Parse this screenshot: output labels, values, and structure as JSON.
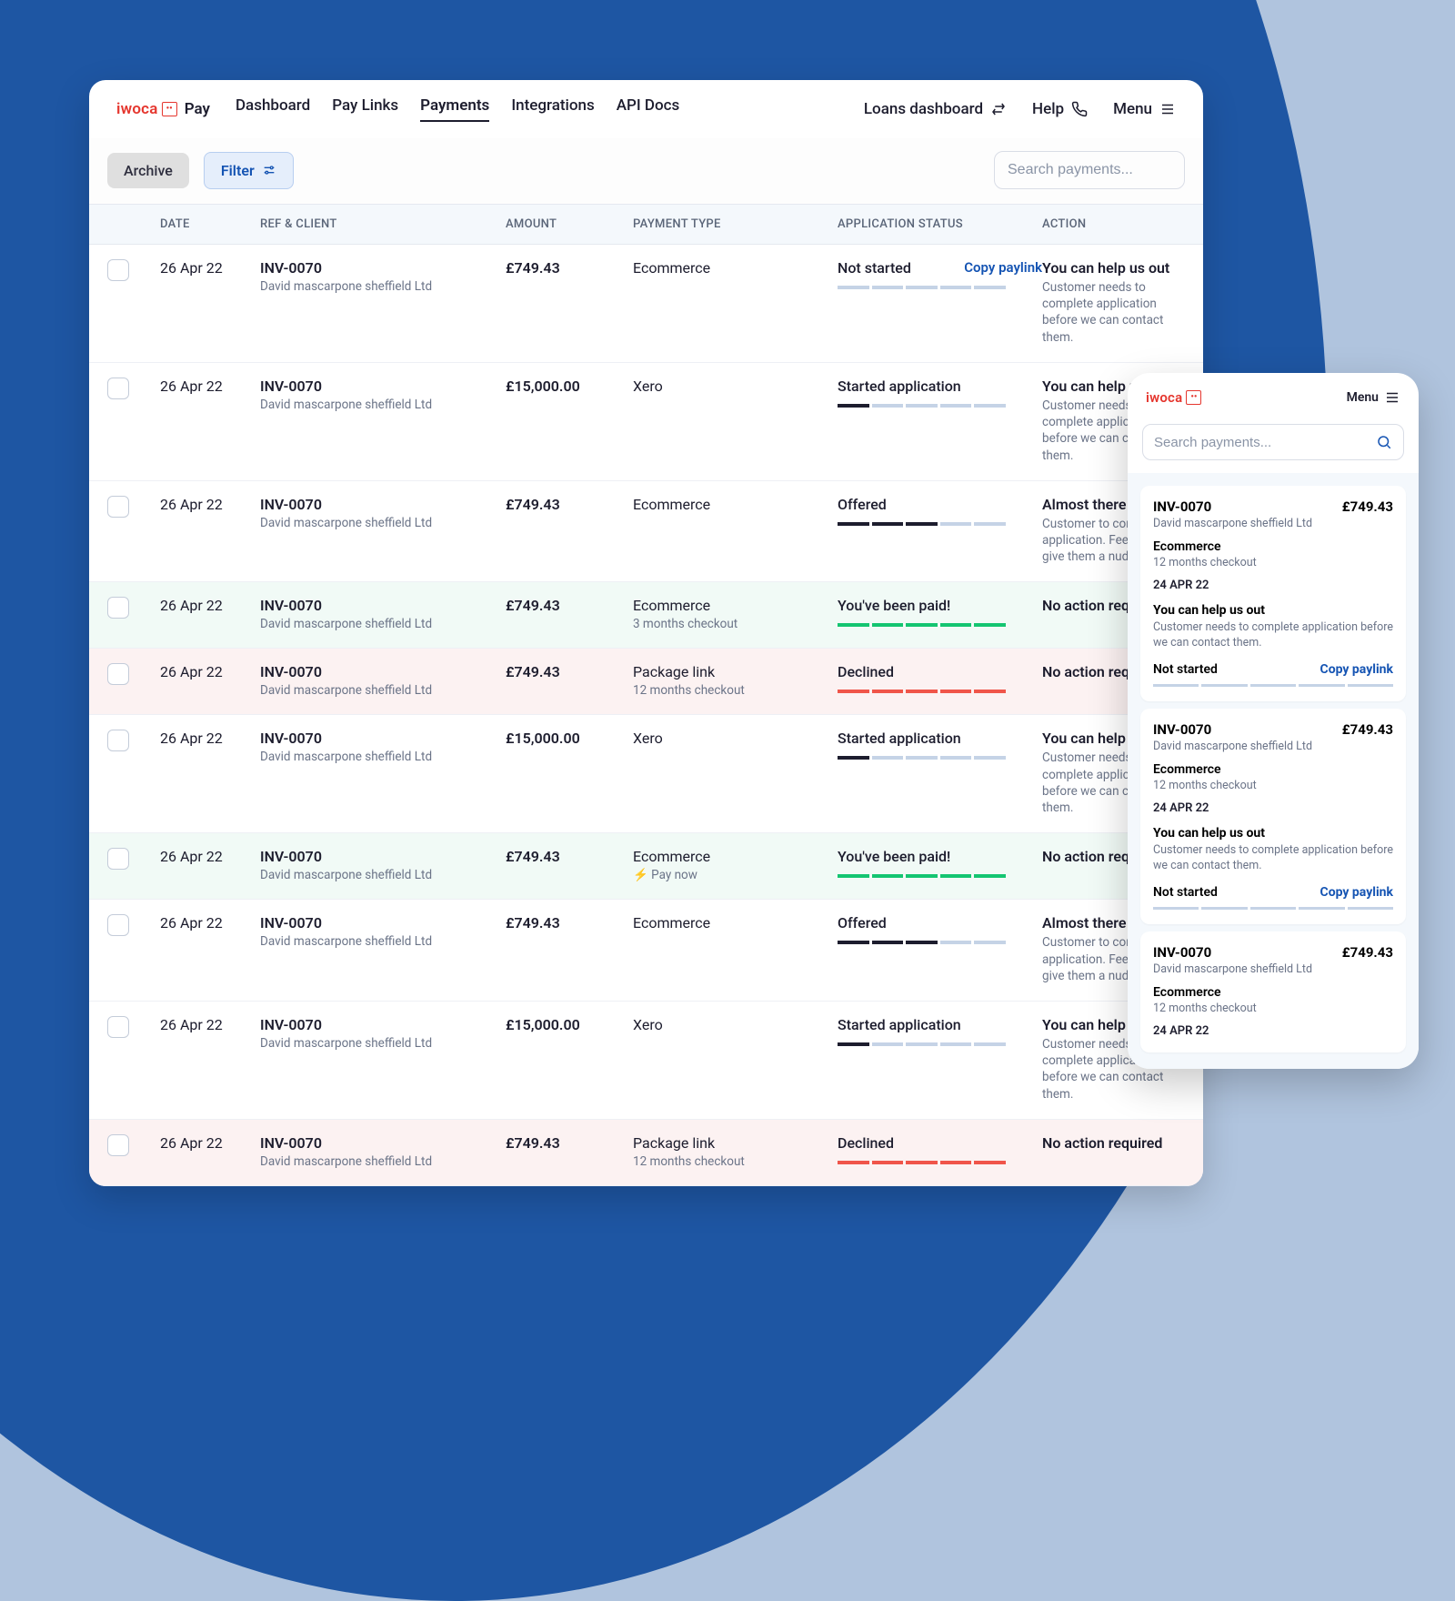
{
  "brand": {
    "iwoca": "iwoca",
    "box": "••",
    "pay": "Pay"
  },
  "nav": {
    "items": [
      "Dashboard",
      "Pay Links",
      "Payments",
      "Integrations",
      "API Docs"
    ],
    "active_index": 2
  },
  "top_right": {
    "loans": "Loans dashboard",
    "help": "Help",
    "menu": "Menu"
  },
  "toolbar": {
    "archive": "Archive",
    "filter": "Filter",
    "search_placeholder": "Search payments..."
  },
  "columns": {
    "date": "DATE",
    "ref": "REF & CLIENT",
    "amount": "AMOUNT",
    "ptype": "PAYMENT TYPE",
    "status": "APPLICATION STATUS",
    "action": "ACTION"
  },
  "copy_link_label": "Copy paylink",
  "rows": [
    {
      "date": "26 Apr 22",
      "ref": "INV-0070",
      "client": "David mascarpone sheffield Ltd",
      "amount": "£749.43",
      "ptype": "Ecommerce",
      "ptype_sub": "",
      "status": "Not started",
      "show_copy": true,
      "progress": [
        "",
        "",
        "",
        "",
        ""
      ],
      "action_title": "You can help us out",
      "action_sub": "Customer needs to complete application before we can contact them.",
      "tint": ""
    },
    {
      "date": "26 Apr 22",
      "ref": "INV-0070",
      "client": "David mascarpone sheffield Ltd",
      "amount": "£15,000.00",
      "ptype": "Xero",
      "ptype_sub": "",
      "status": "Started application",
      "show_copy": false,
      "progress": [
        "fill-dark",
        "",
        "",
        "",
        ""
      ],
      "action_title": "You can help us out",
      "action_sub": "Customer needs to complete application before we can contact them.",
      "tint": ""
    },
    {
      "date": "26 Apr 22",
      "ref": "INV-0070",
      "client": "David mascarpone sheffield Ltd",
      "amount": "£749.43",
      "ptype": "Ecommerce",
      "ptype_sub": "",
      "status": "Offered",
      "show_copy": false,
      "progress": [
        "fill-dark",
        "fill-dark",
        "fill-dark",
        "",
        ""
      ],
      "action_title": "Almost there",
      "action_sub": "Customer to complete application. Feel free to give them a nudge.",
      "tint": ""
    },
    {
      "date": "26 Apr 22",
      "ref": "INV-0070",
      "client": "David mascarpone sheffield Ltd",
      "amount": "£749.43",
      "ptype": "Ecommerce",
      "ptype_sub": "3 months checkout",
      "status": "You've been paid!",
      "show_copy": false,
      "progress": [
        "fill-green",
        "fill-green",
        "fill-green",
        "fill-green",
        "fill-green"
      ],
      "action_title": "No action required",
      "action_sub": "",
      "tint": "green"
    },
    {
      "date": "26 Apr 22",
      "ref": "INV-0070",
      "client": "David mascarpone sheffield Ltd",
      "amount": "£749.43",
      "ptype": "Package link",
      "ptype_sub": "12 months checkout",
      "status": "Declined",
      "show_copy": false,
      "progress": [
        "fill-red",
        "fill-red",
        "fill-red",
        "fill-red",
        "fill-red"
      ],
      "action_title": "No action required",
      "action_sub": "",
      "tint": "red"
    },
    {
      "date": "26 Apr 22",
      "ref": "INV-0070",
      "client": "David mascarpone sheffield Ltd",
      "amount": "£15,000.00",
      "ptype": "Xero",
      "ptype_sub": "",
      "status": "Started application",
      "show_copy": false,
      "progress": [
        "fill-dark",
        "",
        "",
        "",
        ""
      ],
      "action_title": "You can help us out",
      "action_sub": "Customer needs to complete application before we can contact them.",
      "tint": ""
    },
    {
      "date": "26 Apr 22",
      "ref": "INV-0070",
      "client": "David mascarpone sheffield Ltd",
      "amount": "£749.43",
      "ptype": "Ecommerce",
      "ptype_sub": "⚡ Pay now",
      "status": "You've been paid!",
      "show_copy": false,
      "progress": [
        "fill-green",
        "fill-green",
        "fill-green",
        "fill-green",
        "fill-green"
      ],
      "action_title": "No action required",
      "action_sub": "",
      "tint": "green"
    },
    {
      "date": "26 Apr 22",
      "ref": "INV-0070",
      "client": "David mascarpone sheffield Ltd",
      "amount": "£749.43",
      "ptype": "Ecommerce",
      "ptype_sub": "",
      "status": "Offered",
      "show_copy": false,
      "progress": [
        "fill-dark",
        "fill-dark",
        "fill-dark",
        "",
        ""
      ],
      "action_title": "Almost there",
      "action_sub": "Customer to complete application. Feel free to give them a nudge.",
      "tint": ""
    },
    {
      "date": "26 Apr 22",
      "ref": "INV-0070",
      "client": "David mascarpone sheffield Ltd",
      "amount": "£15,000.00",
      "ptype": "Xero",
      "ptype_sub": "",
      "status": "Started application",
      "show_copy": false,
      "progress": [
        "fill-dark",
        "",
        "",
        "",
        ""
      ],
      "action_title": "You can help us out",
      "action_sub": "Customer needs to complete application before we can contact them.",
      "tint": ""
    },
    {
      "date": "26 Apr 22",
      "ref": "INV-0070",
      "client": "David mascarpone sheffield Ltd",
      "amount": "£749.43",
      "ptype": "Package link",
      "ptype_sub": "12 months checkout",
      "status": "Declined",
      "show_copy": false,
      "progress": [
        "fill-red",
        "fill-red",
        "fill-red",
        "fill-red",
        "fill-red"
      ],
      "action_title": "No action required",
      "action_sub": "",
      "tint": "red"
    }
  ],
  "mobile": {
    "menu": "Menu",
    "search_placeholder": "Search payments...",
    "cards": [
      {
        "ref": "INV-0070",
        "client": "David mascarpone sheffield Ltd",
        "amount": "£749.43",
        "ptype": "Ecommerce",
        "ptype_sub": "12 months checkout",
        "date": "24 APR 22",
        "action_title": "You can help us out",
        "action_sub": "Customer needs to complete application before we can contact them.",
        "status": "Not started",
        "copy": "Copy paylink",
        "full": true
      },
      {
        "ref": "INV-0070",
        "client": "David mascarpone sheffield Ltd",
        "amount": "£749.43",
        "ptype": "Ecommerce",
        "ptype_sub": "12 months checkout",
        "date": "24 APR 22",
        "action_title": "You can help us out",
        "action_sub": "Customer needs to complete application before we can contact them.",
        "status": "Not started",
        "copy": "Copy paylink",
        "full": true
      },
      {
        "ref": "INV-0070",
        "client": "David mascarpone sheffield Ltd",
        "amount": "£749.43",
        "ptype": "Ecommerce",
        "ptype_sub": "12 months checkout",
        "date": "24 APR 22",
        "full": false
      }
    ]
  }
}
